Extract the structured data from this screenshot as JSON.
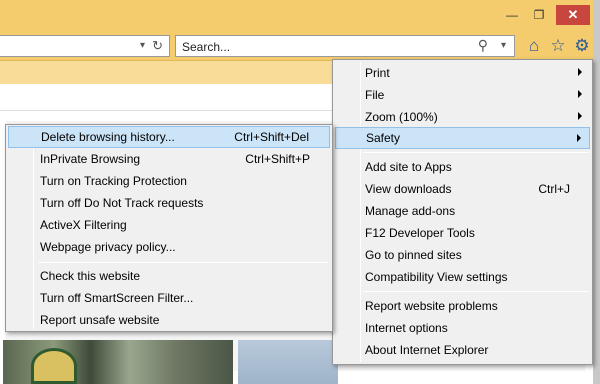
{
  "window": {
    "minimize_icon": "minimize-icon",
    "maximize_icon": "restore-icon",
    "close_icon": "close-icon"
  },
  "navbar": {
    "address_value": "",
    "search_placeholder": "Search...",
    "icons": [
      "dropdown-icon",
      "refresh-icon",
      "search-icon",
      "home-icon",
      "favorites-star-icon",
      "tools-gear-icon"
    ]
  },
  "tools_menu": {
    "items": [
      {
        "label": "Print",
        "has_submenu": true
      },
      {
        "label": "File",
        "has_submenu": true
      },
      {
        "label": "Zoom (100%)",
        "has_submenu": true
      },
      {
        "label": "Safety",
        "has_submenu": true,
        "highlighted": true
      },
      {
        "label": "Add site to Apps"
      },
      {
        "label": "View downloads",
        "shortcut": "Ctrl+J"
      },
      {
        "label": "Manage add-ons"
      },
      {
        "label": "F12 Developer Tools"
      },
      {
        "label": "Go to pinned sites"
      },
      {
        "label": "Compatibility View settings"
      },
      {
        "label": "Report website problems"
      },
      {
        "label": "Internet options"
      },
      {
        "label": "About Internet Explorer"
      }
    ]
  },
  "safety_menu": {
    "items": [
      {
        "label": "Delete browsing history...",
        "shortcut": "Ctrl+Shift+Del",
        "highlighted": true
      },
      {
        "label": "InPrivate Browsing",
        "shortcut": "Ctrl+Shift+P"
      },
      {
        "label": "Turn on Tracking Protection"
      },
      {
        "label": "Turn off Do Not Track requests"
      },
      {
        "label": "ActiveX Filtering"
      },
      {
        "label": "Webpage privacy policy..."
      },
      {
        "label": "Check this website"
      },
      {
        "label": "Turn off SmartScreen Filter..."
      },
      {
        "label": "Report unsafe website"
      }
    ]
  },
  "colors": {
    "chrome": "#f4cc6e",
    "highlight": "#cce4f7",
    "close_button": "#c7463d"
  }
}
